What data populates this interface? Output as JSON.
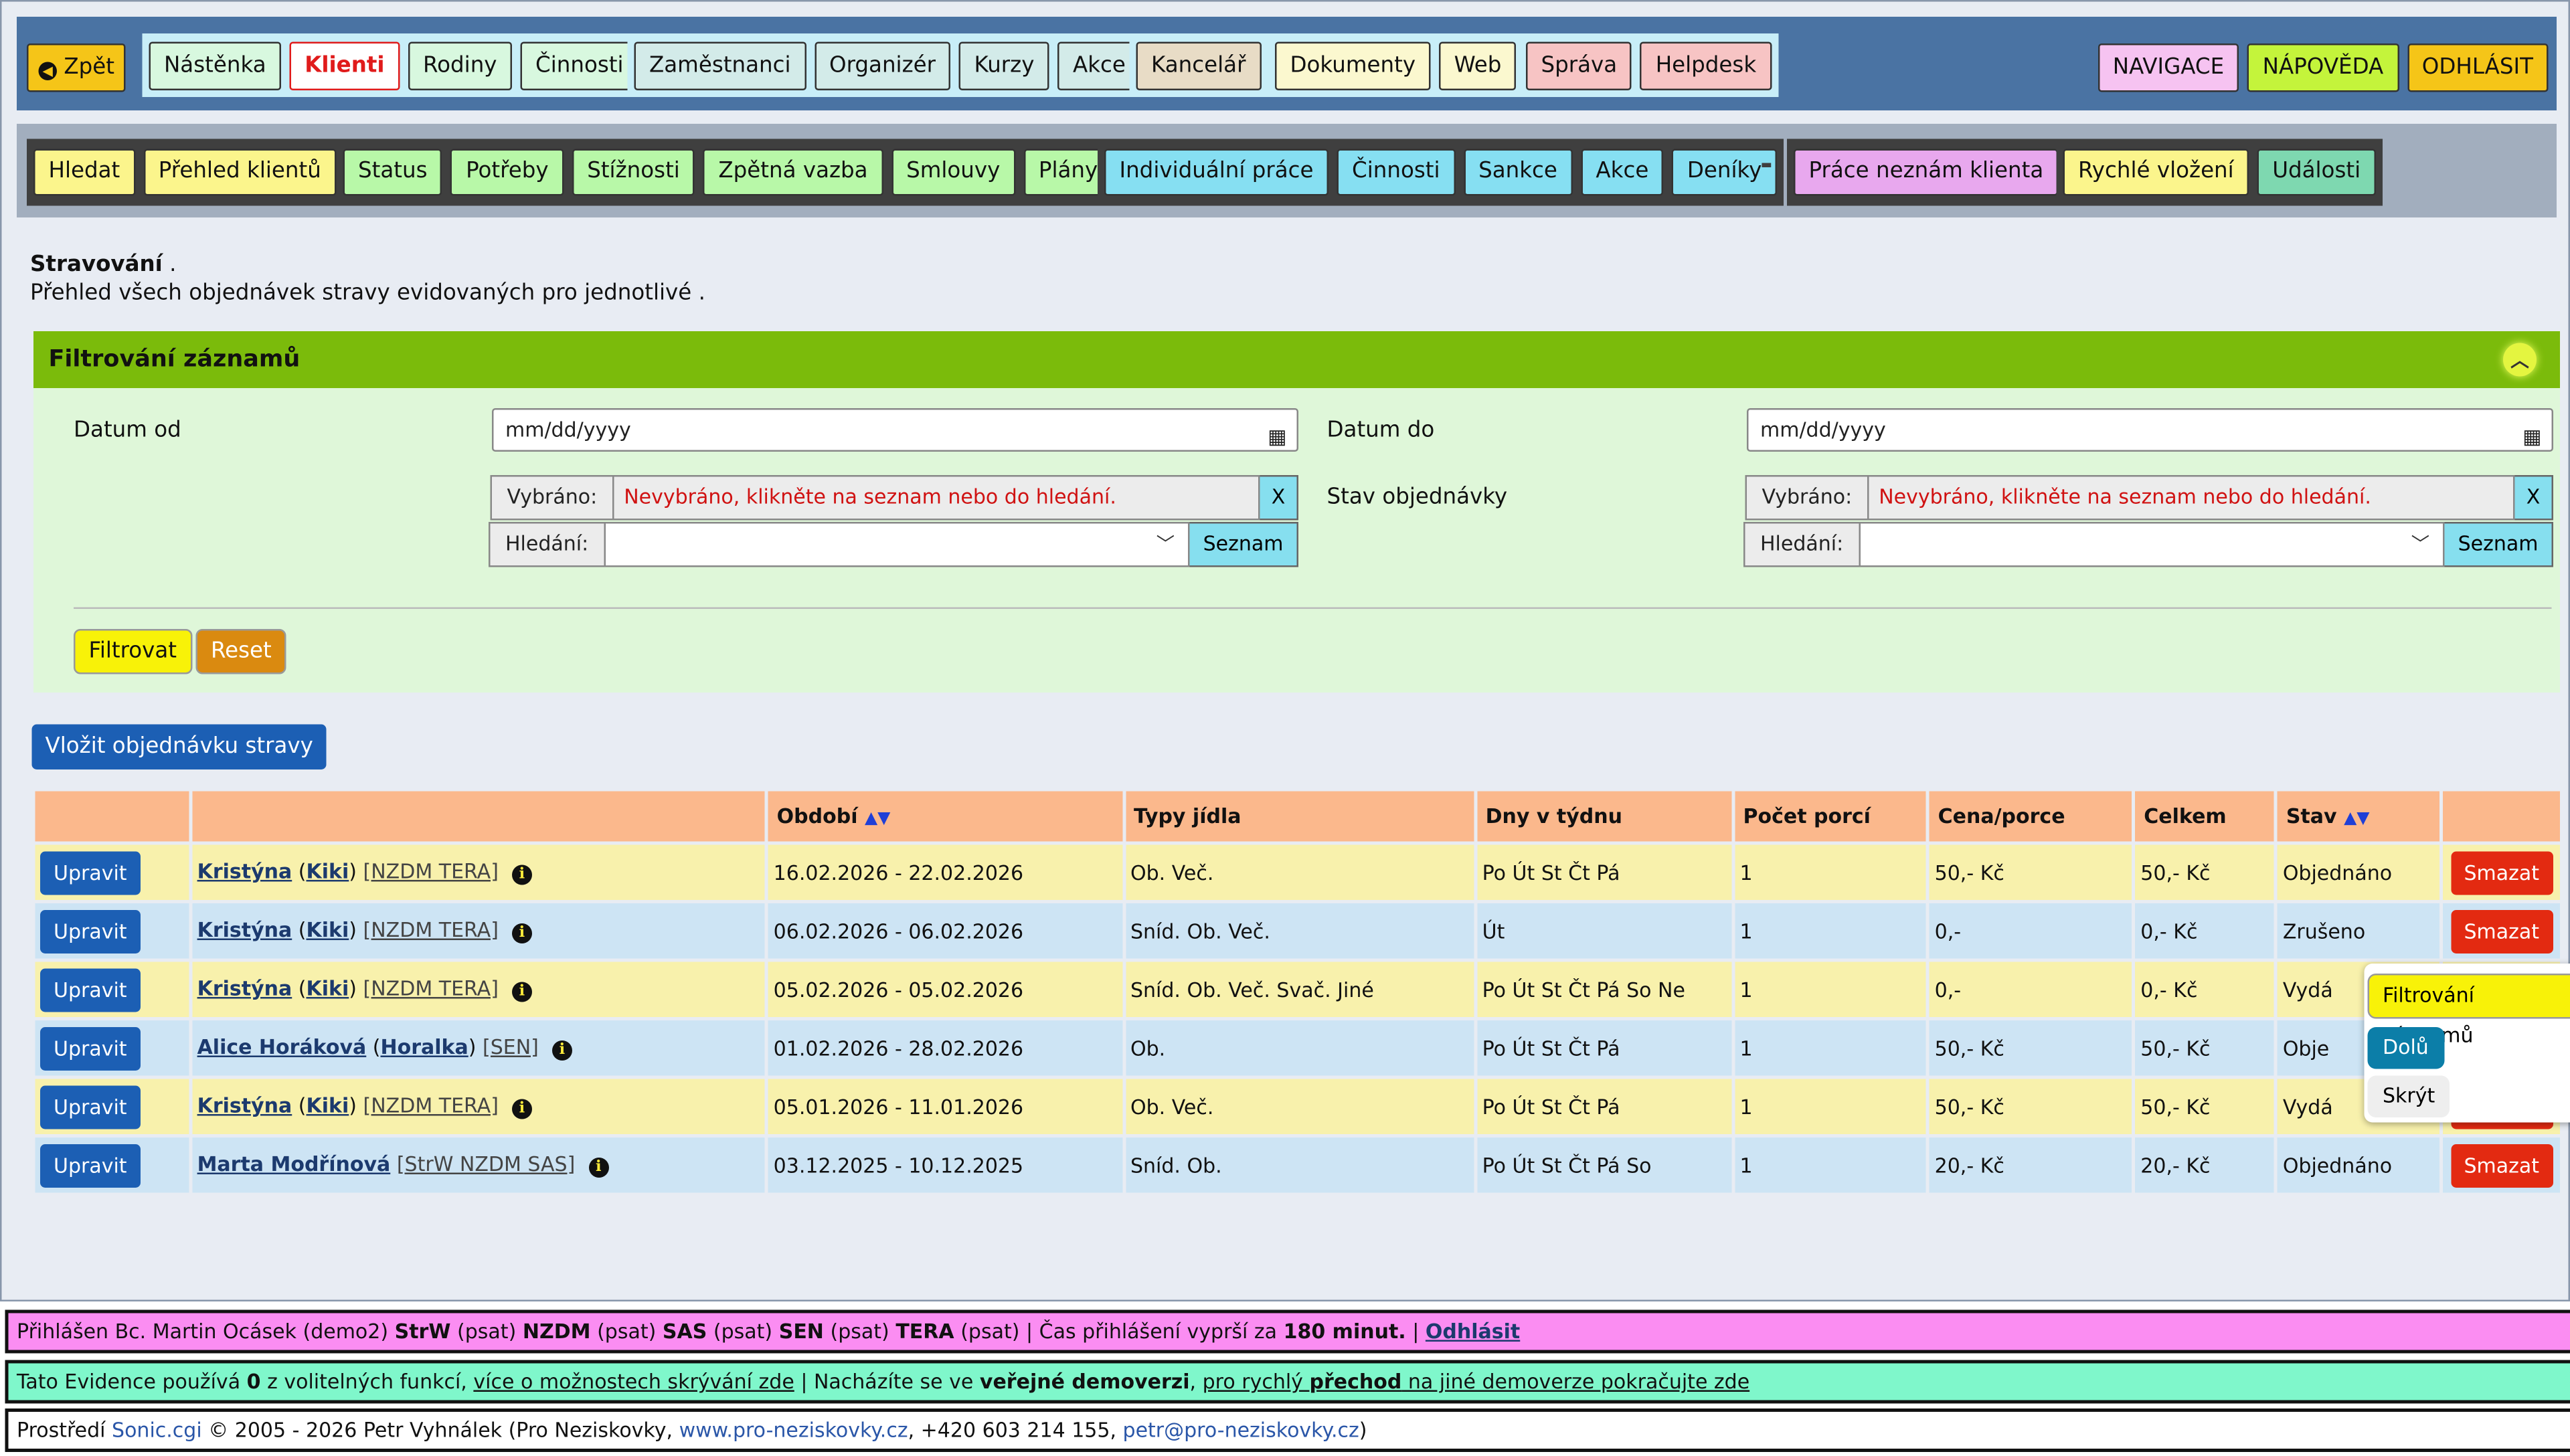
{
  "topnav": {
    "back": "Zpět",
    "groups": [
      [
        "Nástěnka",
        "Klienti",
        "Rodiny",
        "Činnosti"
      ],
      [
        "Zaměstnanci",
        "Organizér",
        "Kurzy",
        "Akce"
      ],
      [
        "Kancelář"
      ],
      [
        "Dokumenty",
        "Web"
      ],
      [
        "Správa",
        "Helpdesk"
      ]
    ],
    "right": [
      "NAVIGACE",
      "NÁPOVĚDA",
      "ODHLÁSIT"
    ]
  },
  "subnav": {
    "groups": [
      [
        "Hledat",
        "Přehled klientů"
      ],
      [
        "Status",
        "Potřeby",
        "Stížnosti",
        "Zpětná vazba",
        "Smlouvy",
        "Plány"
      ],
      [
        "Individuální práce",
        "Činnosti",
        "Sankce",
        "Akce",
        "Deníky"
      ],
      [
        "Práce neznám klienta"
      ],
      [
        "Rychlé vložení",
        "Události"
      ]
    ],
    "separator": "-"
  },
  "page": {
    "title": "Stravování",
    "title_suffix": " .",
    "subtitle": "Přehled všech objednávek stravy evidovaných pro jednotlivé ."
  },
  "filter": {
    "heading": "Filtrování záznamů",
    "date_from_label": "Datum od",
    "date_to_label": "Datum do",
    "date_placeholder": "mm/dd/yyyy",
    "status_label": "Stav objednávky",
    "selected_label": "Vybráno:",
    "selected_value": "Nevybráno, klikněte na seznam nebo do hledání.",
    "clear": "X",
    "search_label": "Hledání:",
    "list_button": "Seznam",
    "filter_button": "Filtrovat",
    "reset_button": "Reset"
  },
  "insert_button": "Vložit objednávku stravy",
  "table": {
    "headers": [
      "",
      "",
      "Období",
      "Typy jídla",
      "Dny v týdnu",
      "Počet porcí",
      "Cena/porce",
      "Celkem",
      "Stav",
      ""
    ],
    "sort_arrows": "▲▼",
    "edit_label": "Upravit",
    "delete_label": "Smazat",
    "rows": [
      {
        "name": "Kristýna",
        "nick": "Kiki",
        "groups": "[NZDM TERA]",
        "period": "16.02.2026 - 22.02.2026",
        "meals": "Ob. Več.",
        "days": "Po Út St Čt Pá",
        "portions": "1",
        "price": "50,- Kč",
        "total": "50,- Kč",
        "status": "Objednáno"
      },
      {
        "name": "Kristýna",
        "nick": "Kiki",
        "groups": "[NZDM TERA]",
        "period": "06.02.2026 - 06.02.2026",
        "meals": "Sníd. Ob. Več.",
        "days": "Út",
        "portions": "1",
        "price": "0,-",
        "total": "0,- Kč",
        "status": "Zrušeno"
      },
      {
        "name": "Kristýna",
        "nick": "Kiki",
        "groups": "[NZDM TERA]",
        "period": "05.02.2026 - 05.02.2026",
        "meals": "Sníd. Ob. Več. Svač. Jiné",
        "days": "Po Út St Čt Pá So Ne",
        "portions": "1",
        "price": "0,-",
        "total": "0,- Kč",
        "status": "Vydá"
      },
      {
        "name": "Alice Horáková",
        "nick": "Horalka",
        "groups": "[SEN]",
        "period": "01.02.2026 - 28.02.2026",
        "meals": "Ob.",
        "days": "Po Út St Čt Pá",
        "portions": "1",
        "price": "50,- Kč",
        "total": "50,- Kč",
        "status": "Obje"
      },
      {
        "name": "Kristýna",
        "nick": "Kiki",
        "groups": "[NZDM TERA]",
        "period": "05.01.2026 - 11.01.2026",
        "meals": "Ob. Več.",
        "days": "Po Út St Čt Pá",
        "portions": "1",
        "price": "50,- Kč",
        "total": "50,- Kč",
        "status": "Vydá"
      },
      {
        "name": "Marta Modřínová",
        "nick": "",
        "groups": "[StrW NZDM SAS]",
        "period": "03.12.2025 - 10.12.2025",
        "meals": "Sníd. Ob.",
        "days": "Po Út St Čt Pá So",
        "portions": "1",
        "price": "20,- Kč",
        "total": "20,- Kč",
        "status": "Objednáno"
      }
    ]
  },
  "popup": {
    "title": "Filtrování záznamů",
    "down": "Dolů",
    "hide": "Skrýt"
  },
  "footer": {
    "line1_prefix": "Přihlášen Bc. Martin Ocásek (demo2) ",
    "teams": [
      {
        "code": "StrW",
        "role": "(psat)"
      },
      {
        "code": "NZDM",
        "role": "(psat)"
      },
      {
        "code": "SAS",
        "role": "(psat)"
      },
      {
        "code": "SEN",
        "role": "(psat)"
      },
      {
        "code": "TERA",
        "role": "(psat)"
      }
    ],
    "sep": " | ",
    "expiry_prefix": "Čas přihlášení vyprší za ",
    "expiry_value": "180 minut.",
    "logout": "Odhlásit",
    "line2_a": "Tato Evidence používá ",
    "line2_count": "0",
    "line2_b": " z volitelných funkcí, ",
    "line2_link": "více o možnostech skrývání zde",
    "line2_c": "Nacházíte se ve ",
    "line2_bold": "veřejné demoverzi",
    "line2_d": ", ",
    "line2_link2a": "pro rychlý ",
    "line2_link2b": "přechod",
    "line2_link2c": " na jiné demoverze pokračujte zde",
    "line3_a": "Prostředí ",
    "line3_sonic": "Sonic.cgi",
    "line3_b": " © 2005 - 2026 Petr Vyhnálek (Pro Neziskovky, ",
    "line3_web": "www.pro-neziskovky.cz",
    "line3_c": ", +420 603 214 155, ",
    "line3_mail": "petr@pro-neziskovky.cz",
    "line3_d": ")"
  },
  "colors": {
    "topbar": "#4a73a3",
    "filter_header": "#7bbb0b",
    "filter_body": "#dff7d9",
    "row_yellow": "#f8f1ac",
    "row_blue": "#cde4f4",
    "delete": "#e32a11",
    "edit": "#1c5fb4"
  }
}
